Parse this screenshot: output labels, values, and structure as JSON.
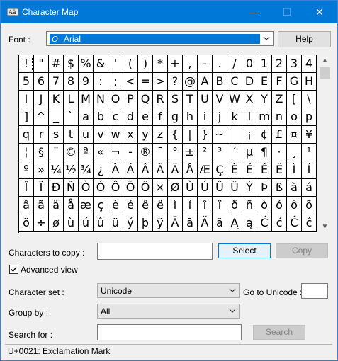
{
  "window": {
    "title": "Character Map",
    "controls": {
      "minimize": "—",
      "maximize": "☐",
      "close": "✕"
    }
  },
  "font": {
    "label": "Font :",
    "selected": "Arial",
    "help_button": "Help"
  },
  "grid": {
    "columns": 20,
    "selected_index": 0,
    "characters": [
      "!",
      "\"",
      "#",
      "$",
      "%",
      "&",
      "'",
      "(",
      ")",
      "*",
      "+",
      ",",
      "-",
      ".",
      "/",
      "0",
      "1",
      "2",
      "3",
      "4",
      "5",
      "6",
      "7",
      "8",
      "9",
      ":",
      ";",
      "<",
      "=",
      ">",
      "?",
      "@",
      "A",
      "B",
      "C",
      "D",
      "E",
      "F",
      "G",
      "H",
      "I",
      "J",
      "K",
      "L",
      "M",
      "N",
      "O",
      "P",
      "Q",
      "R",
      "S",
      "T",
      "U",
      "V",
      "W",
      "X",
      "Y",
      "Z",
      "[",
      "\\",
      "]",
      "^",
      "_",
      "`",
      "a",
      "b",
      "c",
      "d",
      "e",
      "f",
      "g",
      "h",
      "i",
      "j",
      "k",
      "l",
      "m",
      "n",
      "o",
      "p",
      "q",
      "r",
      "s",
      "t",
      "u",
      "v",
      "w",
      "x",
      "y",
      "z",
      "{",
      "|",
      "}",
      "~",
      " ",
      "¡",
      "¢",
      "£",
      "¤",
      "¥",
      "¦",
      "§",
      "¨",
      "©",
      "ª",
      "«",
      "¬",
      "-",
      "®",
      "¯",
      "°",
      "±",
      "²",
      "³",
      "´",
      "µ",
      "¶",
      "·",
      "¸",
      "¹",
      "º",
      "»",
      "¼",
      "½",
      "¾",
      "¿",
      "À",
      "Á",
      "Â",
      "Ã",
      "Ä",
      "Å",
      "Æ",
      "Ç",
      "È",
      "É",
      "Ê",
      "Ë",
      "Ì",
      "Í",
      "Î",
      "Ï",
      "Ð",
      "Ñ",
      "Ò",
      "Ó",
      "Ô",
      "Õ",
      "Ö",
      "×",
      "Ø",
      "Ù",
      "Ú",
      "Û",
      "Ü",
      "Ý",
      "Þ",
      "ß",
      "à",
      "á",
      "â",
      "ã",
      "ä",
      "å",
      "æ",
      "ç",
      "è",
      "é",
      "ê",
      "ë",
      "ì",
      "í",
      "î",
      "ï",
      "ð",
      "ñ",
      "ò",
      "ó",
      "ô",
      "õ",
      "ö",
      "÷",
      "ø",
      "ù",
      "ú",
      "û",
      "ü",
      "ý",
      "þ",
      "ÿ",
      "Ā",
      "ā",
      "Ă",
      "ă",
      "Ą",
      "ą",
      "Ć",
      "ć",
      "Ĉ",
      "ĉ"
    ]
  },
  "copy": {
    "label": "Characters to copy :",
    "value": "",
    "select_button": "Select",
    "copy_button": "Copy"
  },
  "advanced": {
    "label": "Advanced view",
    "checked": true
  },
  "charset": {
    "label": "Character set :",
    "value": "Unicode",
    "goto_label": "Go to Unicode :",
    "goto_value": ""
  },
  "groupby": {
    "label": "Group by :",
    "value": "All"
  },
  "search": {
    "label": "Search for :",
    "value": "",
    "button": "Search"
  },
  "status": {
    "text": "U+0021: Exclamation Mark"
  },
  "colors": {
    "titlebar": "#0078d7",
    "selection": "#0078d7"
  }
}
